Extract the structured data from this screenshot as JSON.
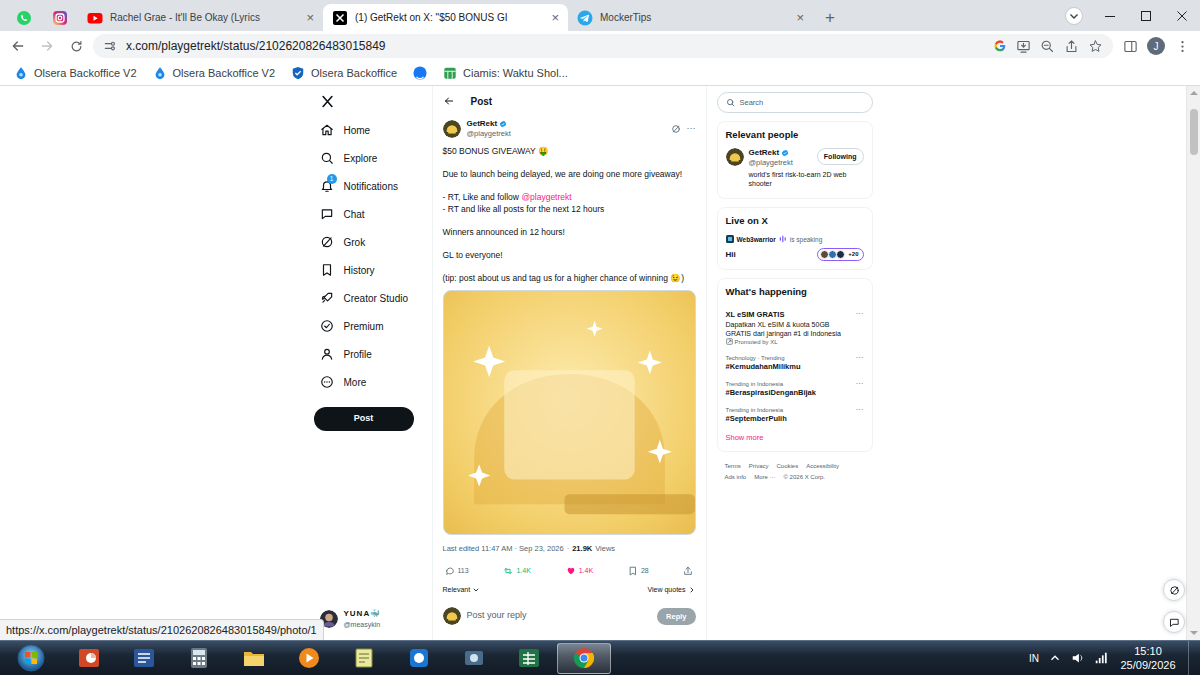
{
  "browser": {
    "tabs": [
      {
        "kind": "whatsapp",
        "selected": false
      },
      {
        "kind": "instagram",
        "selected": false
      },
      {
        "kind": "youtube",
        "label": "Rachel Grae - It'll Be Okay (Lyrics",
        "close": "×",
        "selected": false
      },
      {
        "kind": "x",
        "label": "(1) GetRekt on X: \"$50 BONUS GI",
        "close": "×",
        "selected": true
      },
      {
        "kind": "telegram",
        "label": "MockerTips",
        "close": "×",
        "selected": false
      }
    ],
    "new_tab": "+",
    "address": "x.com/playgetrekt/status/2102620826483015849",
    "profile": "J",
    "bookmarks": [
      {
        "kind": "olsera",
        "label": "Olsera Backoffice V2"
      },
      {
        "kind": "olsera",
        "label": "Olsera Backoffice V2"
      },
      {
        "kind": "shield",
        "label": "Olsera Backoffice"
      },
      {
        "kind": "facebook"
      },
      {
        "kind": "calendar",
        "label": "Ciamis: Waktu Shol..."
      }
    ],
    "status_url": "https://x.com/playgetrekt/status/2102620826483015849/photo/1"
  },
  "x": {
    "nav": [
      {
        "kind": "home",
        "label": "Home",
        "selected": false
      },
      {
        "kind": "explore",
        "label": "Explore",
        "selected": false
      },
      {
        "kind": "notifications",
        "label": "Notifications",
        "badge": "1",
        "selected": false
      },
      {
        "kind": "chat",
        "label": "Chat",
        "selected": false
      },
      {
        "kind": "grok",
        "label": "Grok",
        "selected": false
      },
      {
        "kind": "history",
        "label": "History",
        "selected": false
      },
      {
        "kind": "creator",
        "label": "Creator Studio",
        "selected": false
      },
      {
        "kind": "premium",
        "label": "Premium",
        "selected": false
      },
      {
        "kind": "profile",
        "label": "Profile",
        "selected": false
      },
      {
        "kind": "more",
        "label": "More",
        "selected": false
      }
    ],
    "post_button": "Post",
    "account": {
      "name": "YUNA🐳",
      "handle": "@measykin"
    }
  },
  "post": {
    "title": "Post",
    "author": {
      "name": "GetRekt",
      "handle": "@playgetrekt",
      "verified": true
    },
    "more": "···",
    "paragraphs": [
      [
        {
          "text": "$50 BONUS GIVEAWAY 🤑"
        }
      ],
      [
        {
          "text": "Due to launch being delayed, we are doing one more giveaway!"
        }
      ],
      [
        {
          "text": "- RT, Like and follow",
          "mention": "@playgetrekt"
        },
        {
          "text": "- RT and like all posts for the next 12 hours"
        }
      ],
      [
        {
          "text": "Winners announced in 12 hours!"
        }
      ],
      [
        {
          "text": "GL to everyone!"
        }
      ],
      [
        {
          "text": "(tip: post about us and tag us for a higher chance of winning 😉)"
        }
      ]
    ],
    "edited": "Last edited 11:47 AM · Sep 23, 2026",
    "sep": "·",
    "views": "21.9K",
    "views_label": "Views",
    "actions": [
      {
        "kind": "reply",
        "count": "113",
        "color": "#536471"
      },
      {
        "kind": "repost",
        "count": "1.4K",
        "color": "#00ba7c"
      },
      {
        "kind": "like",
        "count": "1.4K",
        "color": "#f91880"
      },
      {
        "kind": "bookmark",
        "count": "28",
        "color": "#536471"
      },
      {
        "kind": "share",
        "color": "#536471"
      }
    ],
    "sort": "Relevant",
    "view_quotes": "View quotes",
    "reply": {
      "placeholder": "Post your reply",
      "button": "Reply",
      "disabled": true
    }
  },
  "sidebar": {
    "search": {
      "placeholder": "Search"
    },
    "relevant": {
      "title": "Relevant people",
      "people": [
        {
          "name": "GetRekt",
          "handle": "@playgetrekt",
          "verified": true,
          "button": "Following",
          "bio": "world's first risk-to-earn 2D web shooter"
        }
      ]
    },
    "live": {
      "title": "Live on X",
      "host": "Web3warrior",
      "status": "is speaking",
      "topic": "Hii",
      "listeners": "+20"
    },
    "trends": {
      "title": "What's happening",
      "items": [
        {
          "kind": "promoted",
          "title": "XL eSIM GRATIS",
          "desc": "Dapatkan XL eSIM & kuota 50GB GRATIS dari jaringan #1 di Indonesia",
          "context": "Promoted by XL",
          "more": "···"
        },
        {
          "kind": "trend",
          "context": "Technology · Trending",
          "title": "#KemudahanMilikmu",
          "more": "···"
        },
        {
          "kind": "trend",
          "context": "Trending in Indonesia",
          "title": "#BeraspirasiDenganBijak",
          "more": "···"
        },
        {
          "kind": "trend",
          "context": "Trending in Indonesia",
          "title": "#SeptemberPulih",
          "more": "···"
        }
      ],
      "show_more": "Show more"
    },
    "footer": [
      "Terms",
      "Privacy",
      "Cookies",
      "Accessibility",
      "Ads info",
      "More ···",
      "© 2026 X Corp."
    ]
  },
  "taskbar": {
    "apps": [
      {
        "kind": "powerpoint",
        "selected": false
      },
      {
        "kind": "word",
        "selected": false
      },
      {
        "kind": "calculator",
        "selected": false
      },
      {
        "kind": "explorer",
        "selected": false
      },
      {
        "kind": "media",
        "selected": false
      },
      {
        "kind": "notes",
        "selected": false
      },
      {
        "kind": "pos",
        "selected": false
      },
      {
        "kind": "camera",
        "selected": false
      },
      {
        "kind": "excel",
        "selected": false
      },
      {
        "kind": "chrome",
        "selected": true
      }
    ],
    "lang": "IN",
    "time": "15:10",
    "date": "25/09/2026"
  }
}
